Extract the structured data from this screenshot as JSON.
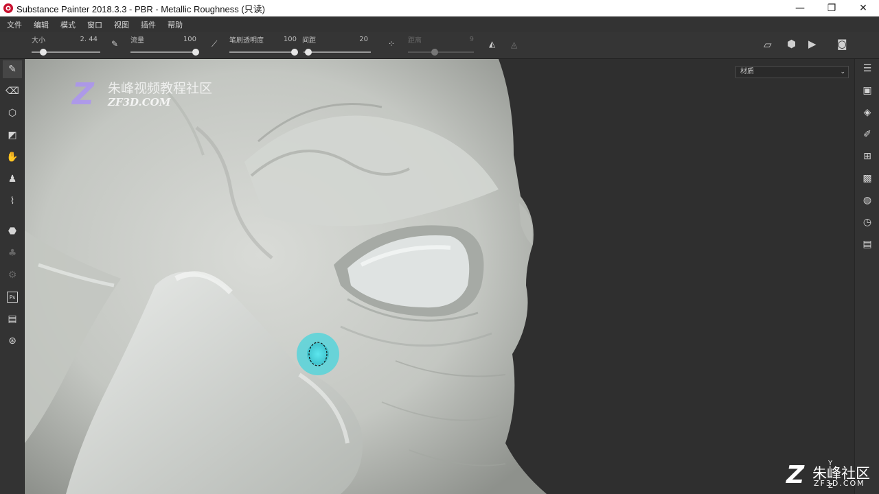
{
  "window": {
    "title": "Substance Painter 2018.3.3 - PBR - Metallic Roughness (只读)",
    "minimize": "—",
    "restore": "❐",
    "close": "✕"
  },
  "menu": [
    "文件",
    "编辑",
    "模式",
    "窗口",
    "视图",
    "插件",
    "帮助"
  ],
  "toolbar": {
    "size": {
      "label": "大小",
      "value": "2. 44"
    },
    "flow": {
      "label": "流量",
      "value": "100"
    },
    "stroke_opacity": {
      "label": "笔刷透明度",
      "value": "100"
    },
    "spacing": {
      "label": "间距",
      "value": "20"
    },
    "distance": {
      "label": "距离",
      "value": "9"
    }
  },
  "material_dropdown": {
    "selected": "材质"
  },
  "watermark": {
    "logo_letter": "Z",
    "chinese": "朱峰视频教程社区",
    "english": "ZF3D.COM"
  },
  "corner_watermark": {
    "logo_letter": "Z",
    "chinese": "朱峰社区",
    "english": "ZF3D.COM"
  },
  "axis": {
    "y": "Y",
    "z": "Z"
  },
  "left_tools": [
    "paint-brush",
    "eraser",
    "projection",
    "polygon-fill",
    "smudge",
    "clone-stamp",
    "color-picker",
    "bake",
    "notification",
    "settings-gear",
    "photoshop-export",
    "document-check",
    "plugin"
  ],
  "right_tools": [
    "layers-list",
    "texture-set",
    "stack",
    "brush-properties",
    "display-grid",
    "render-settings",
    "environment",
    "history",
    "log"
  ],
  "colors": {
    "brush_cursor": "#47d4dc",
    "viewport_bg": "#2f2f2f",
    "panel_bg": "#333333"
  }
}
